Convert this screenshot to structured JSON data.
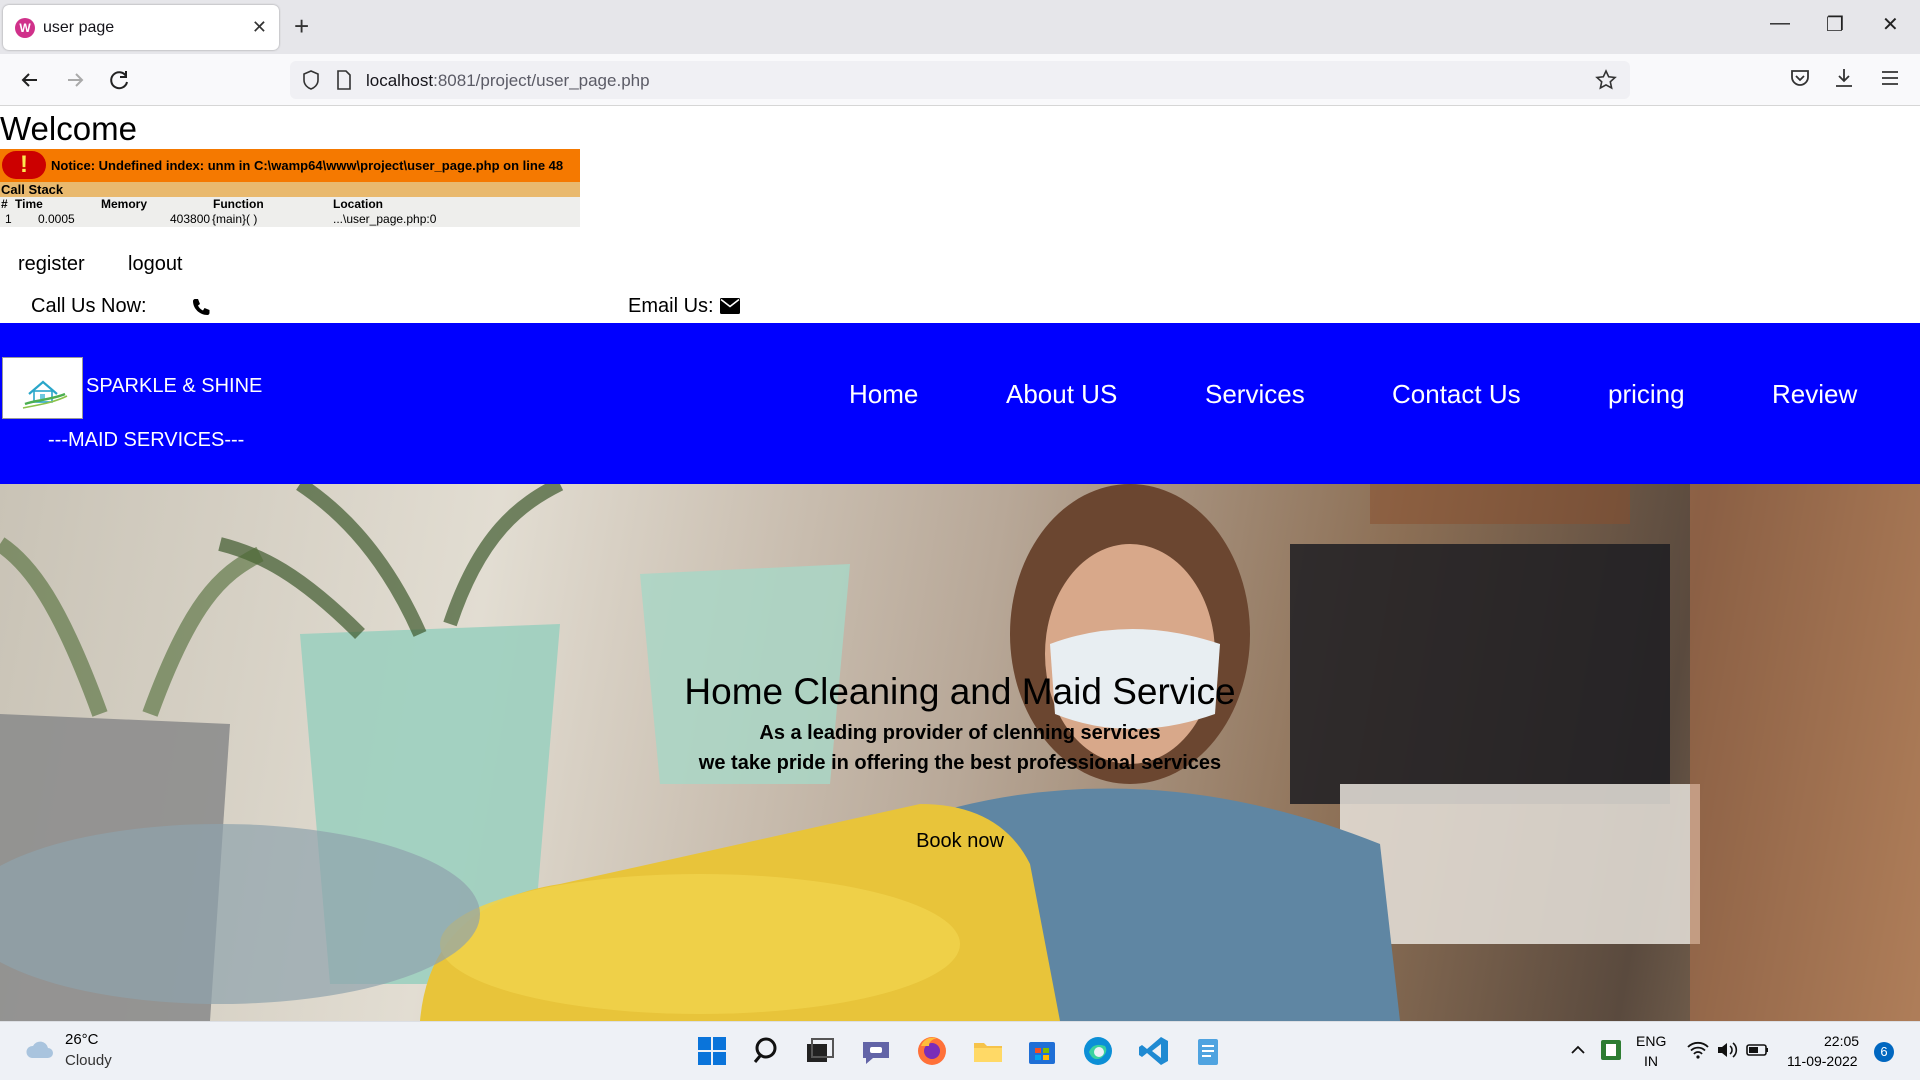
{
  "browser": {
    "tab_title": "user page",
    "url_host": "localhost",
    "url_rest": ":8081/project/user_page.php"
  },
  "page": {
    "welcome": "Welcome",
    "xdebug": {
      "icon": "( ! )",
      "message": "Notice: Undefined index: unm in C:\\wamp64\\www\\project\\user_page.php on line 48",
      "stack_label": "Call Stack",
      "headers": [
        "#",
        "Time",
        "Memory",
        "Function",
        "Location"
      ],
      "row": [
        "1",
        "0.0005",
        "403800",
        "{main}( )",
        "...\\user_page.php:0"
      ]
    },
    "links": {
      "register": "register",
      "logout": "logout"
    },
    "call_label": "Call Us Now:",
    "email_label": "Email Us:",
    "header": {
      "brand": "SPARKLE & SHINE",
      "tagline": "---MAID SERVICES---",
      "menu": [
        "Home",
        "About US",
        "Services",
        "Contact Us",
        "pricing",
        "Review"
      ]
    },
    "hero": {
      "title": "Home Cleaning and Maid Service",
      "sub1": "As a leading provider of clenning services",
      "sub2": "we take pride in offering the best professional services",
      "cta": "Book now"
    }
  },
  "taskbar": {
    "temp": "26°C",
    "weather": "Cloudy",
    "lang1": "ENG",
    "lang2": "IN",
    "time": "22:05",
    "date": "11-09-2022",
    "notifications": "6"
  },
  "colors": {
    "header_bg": "#0000ff",
    "xdebug_orange": "#f57900",
    "xdebug_tan": "#e9b96e"
  }
}
